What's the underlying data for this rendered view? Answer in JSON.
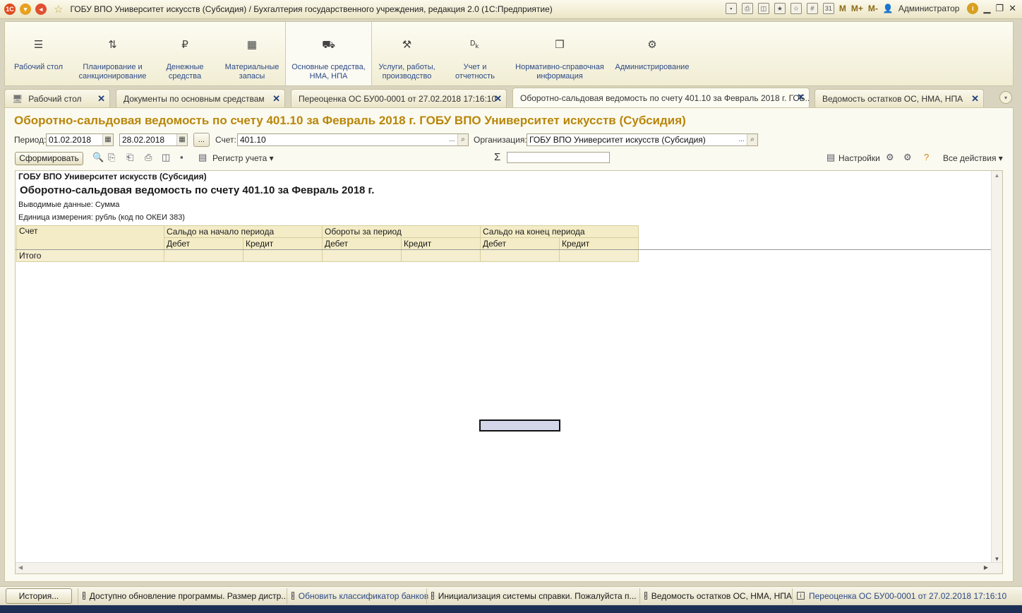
{
  "window": {
    "title": "ГОБУ ВПО Университет искусств (Субсидия) / Бухгалтерия государственного учреждения, редакция 2.0  (1С:Предприятие)",
    "user": "Администратор",
    "m_labels": [
      "M",
      "M+",
      "M-"
    ]
  },
  "sections": [
    {
      "label": "Рабочий стол",
      "icon": "menu-icon"
    },
    {
      "label": "Планирование и санкционирование",
      "icon": "planning-icon"
    },
    {
      "label": "Денежные средства",
      "icon": "ruble-icon"
    },
    {
      "label": "Материальные запасы",
      "icon": "grid-icon"
    },
    {
      "label": "Основные средства, НМА, НПА",
      "icon": "truck-icon"
    },
    {
      "label": "Услуги, работы, производство",
      "icon": "tools-icon"
    },
    {
      "label": "Учет и отчетность",
      "icon": "ledger-icon"
    },
    {
      "label": "Нормативно-справочная информация",
      "icon": "books-icon"
    },
    {
      "label": "Администрирование",
      "icon": "gear-icon"
    }
  ],
  "tabs": [
    {
      "label": "Рабочий стол"
    },
    {
      "label": "Документы по основным средствам"
    },
    {
      "label": "Переоценка ОС БУ00-0001 от 27.02.2018 17:16:10"
    },
    {
      "label": "Оборотно-сальдовая ведомость по счету 401.10 за Февраль 2018 г. ГОБ..."
    },
    {
      "label": "Ведомость остатков ОС, НМА, НПА"
    }
  ],
  "form": {
    "title": "Оборотно-сальдовая ведомость по счету 401.10 за Февраль 2018 г. ГОБУ ВПО Университет искусств (Субсидия)",
    "period_label": "Период:",
    "date_from": "01.02.2018",
    "date_to": "28.02.2018",
    "account_label": "Счет:",
    "account_value": "401.10",
    "org_label": "Организация:",
    "org_value": "ГОБУ ВПО Университет искусств (Субсидия)",
    "generate_button": "Сформировать",
    "register_button": "Регистр учета",
    "sum_symbol": "Σ",
    "settings_button": "Настройки",
    "all_actions_button": "Все действия"
  },
  "report": {
    "org": "ГОБУ ВПО Университет искусств (Субсидия)",
    "title": "Оборотно-сальдовая ведомость по счету 401.10 за Февраль 2018 г.",
    "output_data": "Выводимые данные:  Сумма",
    "unit": "Единица измерения: рубль (код по ОКЕИ 383)",
    "col_account": "Счет",
    "col_group1": "Сальдо на начало периода",
    "col_group2": "Обороты за период",
    "col_group3": "Сальдо на конец периода",
    "debit": "Дебет",
    "credit": "Кредит",
    "total": "Итого"
  },
  "statusbar": {
    "history_button": "История...",
    "messages": [
      {
        "text": "Доступно обновление программы. Размер дистр..."
      },
      {
        "text": "Обновить классификатор банков"
      },
      {
        "text": "Инициализация системы справки. Пожалуйста п..."
      },
      {
        "text": "Ведомость остатков ОС, НМА, НПА"
      },
      {
        "text": "Переоценка ОС БУ00-0001 от 27.02.2018 17:16:10"
      }
    ]
  },
  "colors": {
    "accent_title": "#b8860b",
    "link": "#2c4a86",
    "grid_header": "#f4ecc6"
  }
}
